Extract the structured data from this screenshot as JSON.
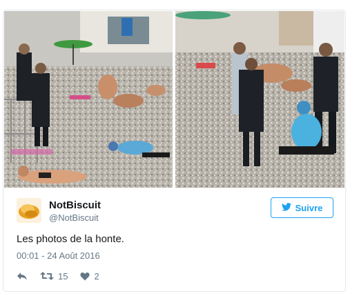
{
  "tweet": {
    "author_name": "NotBiscuit",
    "author_handle": "@NotBiscuit",
    "follow_label": "Suivre",
    "text": "Les photos de la honte.",
    "timestamp": "00:01 - 24 Août 2016",
    "retweet_count": "15",
    "like_count": "2"
  },
  "icons": {
    "follow": "bird-icon",
    "reply": "reply-icon",
    "retweet": "retweet-icon",
    "like": "heart-icon"
  },
  "colors": {
    "accent": "#1da1f2",
    "text": "#14171a",
    "muted": "#657786",
    "border": "#e1e8ed"
  }
}
